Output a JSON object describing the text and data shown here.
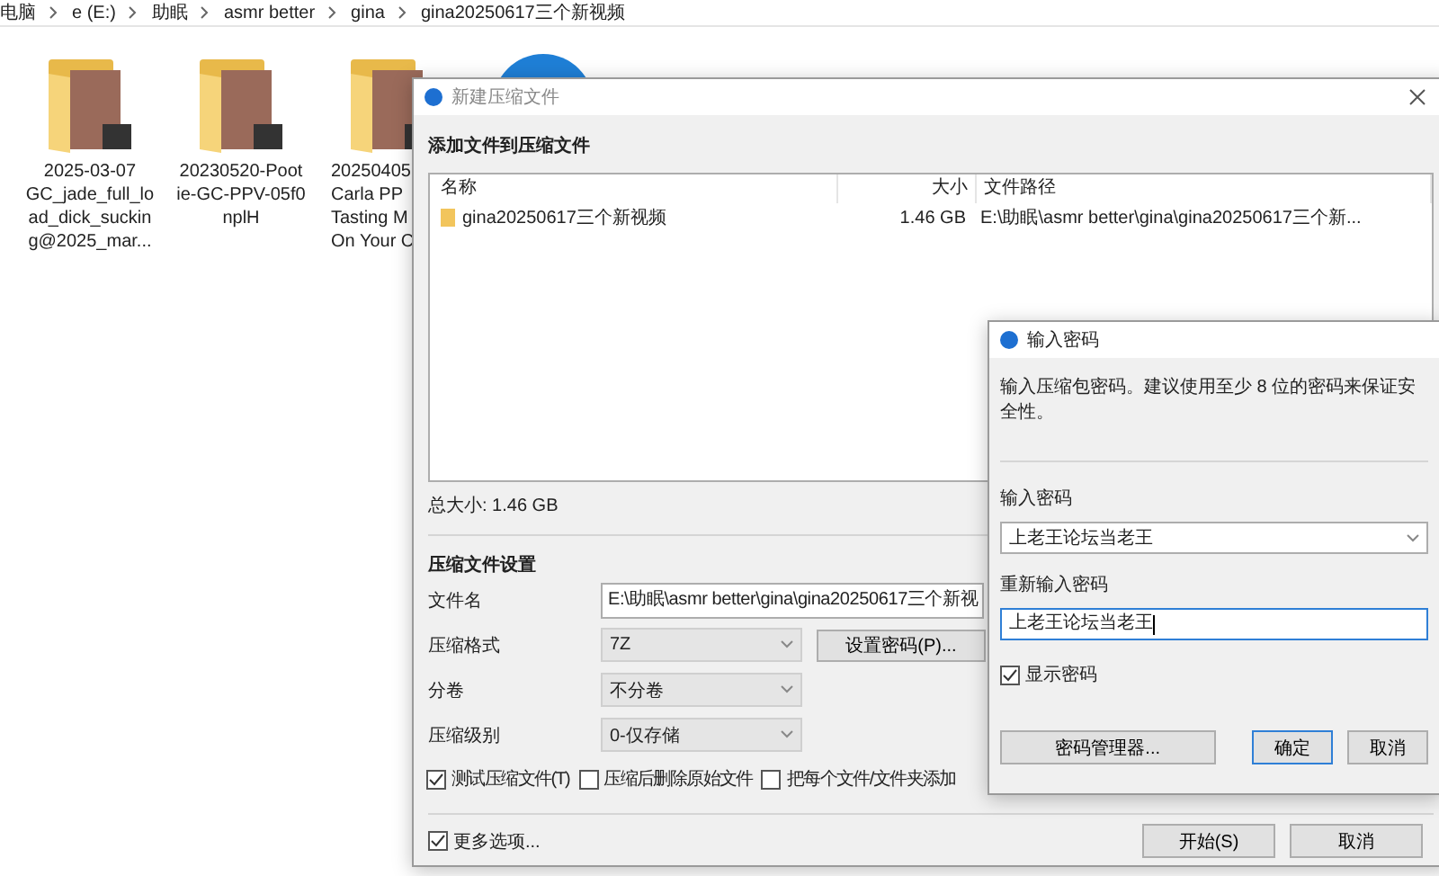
{
  "breadcrumb": [
    "电脑",
    "e (E:)",
    "助眠",
    "asmr better",
    "gina",
    "gina20250617三个新视频"
  ],
  "folders": [
    {
      "lines": [
        "2025-03-07",
        "GC_jade_full_lo",
        "ad_dick_suckin",
        "g@2025_mar..."
      ]
    },
    {
      "lines": [
        "20230520-Poot",
        "ie-GC-PPV-05f0",
        "nplH"
      ]
    },
    {
      "lines": [
        "20250405",
        "Carla PP",
        "Tasting M",
        "On Your C"
      ]
    }
  ],
  "archive_dialog": {
    "title": "新建压缩文件",
    "heading": "添加文件到压缩文件",
    "columns": [
      "名称",
      "大小",
      "文件路径"
    ],
    "rows": [
      {
        "name": "gina20250617三个新视频",
        "size": "1.46 GB",
        "path": "E:\\助眠\\asmr better\\gina\\gina20250617三个新..."
      }
    ],
    "total_size": "总大小: 1.46 GB",
    "settings_title": "压缩文件设置",
    "fields": [
      {
        "kind": "input",
        "label": "文件名",
        "value": "E:\\助眠\\asmr better\\gina\\gina20250617三个新视"
      },
      {
        "kind": "select",
        "label": "压缩格式",
        "value": "7Z",
        "button": "设置密码(P)..."
      },
      {
        "kind": "select",
        "label": "分卷",
        "value": "不分卷"
      },
      {
        "kind": "select",
        "label": "压缩级别",
        "value": "0-仅存储"
      }
    ],
    "options": [
      {
        "label": "测试压缩文件(T)",
        "checked": true
      },
      {
        "label": "压缩后删除原始文件",
        "checked": false
      },
      {
        "label": "把每个文件/文件夹添加",
        "checked": false
      }
    ],
    "more_options": {
      "label": "更多选项...",
      "checked": true
    },
    "buttons": [
      "开始(S)",
      "取消"
    ]
  },
  "password_dialog": {
    "title": "输入密码",
    "description": "输入压缩包密码。建议使用至少 8 位的密码来保证安全性。",
    "password_label": "输入密码",
    "password_value": "上老王论坛当老王",
    "repeat_label": "重新输入密码",
    "repeat_value": "上老王论坛当老王",
    "show_password": {
      "label": "显示密码",
      "checked": true
    },
    "buttons": [
      {
        "label": "密码管理器...",
        "kind": "wide",
        "selected": false
      },
      {
        "label": "确定",
        "kind": "normal",
        "selected": true
      },
      {
        "label": "取消",
        "kind": "normal",
        "selected": false
      }
    ]
  }
}
